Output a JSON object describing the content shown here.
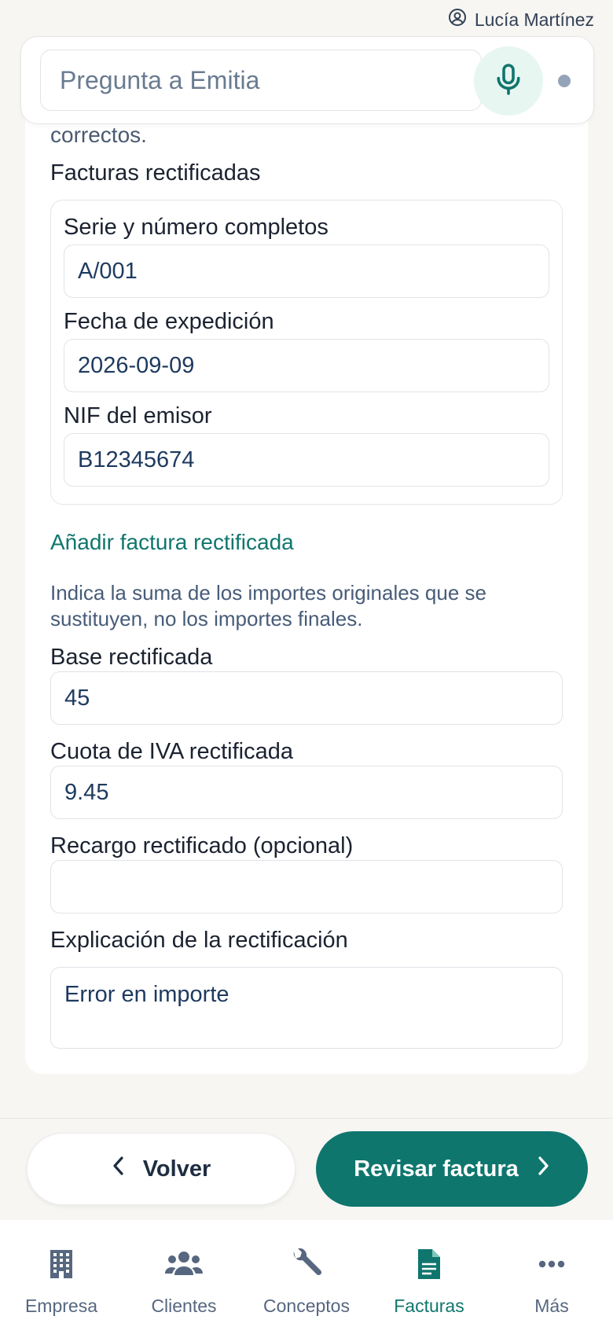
{
  "user": {
    "name": "Lucía Martínez",
    "icon": "user-circle-icon"
  },
  "ask": {
    "placeholder": "Pregunta a Emitia",
    "mic_icon": "microphone-icon"
  },
  "form": {
    "clipped_text": "correctos.",
    "rectified_section_title": "Facturas rectificadas",
    "rectified_invoice": {
      "series_label": "Serie y número completos",
      "series_value": "A/001",
      "date_label": "Fecha de expedición",
      "date_value": "2026-09-09",
      "nif_label": "NIF del emisor",
      "nif_value": "B12345674"
    },
    "add_link": "Añadir factura rectificada",
    "hint": "Indica la suma de los importes originales que se sustituyen, no los importes finales.",
    "base_label": "Base rectificada",
    "base_value": "45",
    "iva_label": "Cuota de IVA rectificada",
    "iva_value": "9.45",
    "recargo_label": "Recargo rectificado (opcional)",
    "recargo_value": "",
    "explanation_label": "Explicación de la rectificación",
    "explanation_value": "Error en importe"
  },
  "actions": {
    "back_label": "Volver",
    "next_label": "Revisar factura"
  },
  "nav": {
    "items": [
      {
        "label": "Empresa",
        "icon": "building-icon"
      },
      {
        "label": "Clientes",
        "icon": "users-icon"
      },
      {
        "label": "Conceptos",
        "icon": "wrench-icon"
      },
      {
        "label": "Facturas",
        "icon": "document-icon"
      },
      {
        "label": "Más",
        "icon": "more-dots-icon"
      }
    ],
    "active": "Facturas"
  },
  "colors": {
    "accent": "#0f766e",
    "background": "#f7f6f3",
    "text": "#1b2230",
    "muted": "#56677f"
  }
}
